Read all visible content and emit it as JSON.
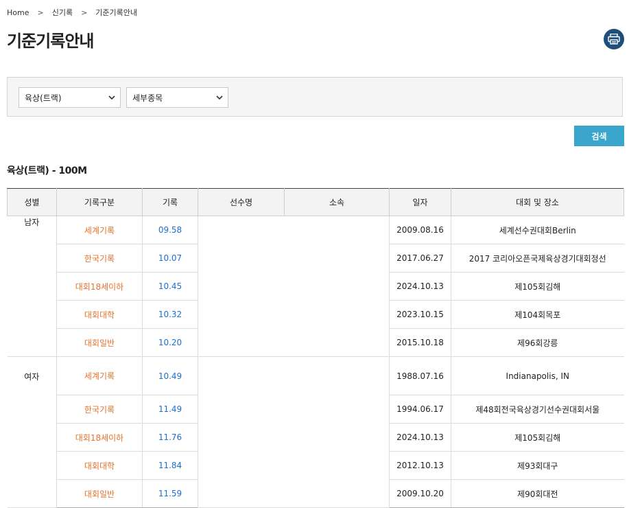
{
  "breadcrumb": {
    "home": "Home",
    "level1": "신기록",
    "level2": "기준기록안내",
    "separator": ">"
  },
  "page_title": "기준기록안내",
  "filters": {
    "category": "육상(트랙)",
    "event": "세부종목"
  },
  "search_label": "검색",
  "section_title": "육상(트랙) - 100M",
  "table": {
    "headers": [
      "성별",
      "기록구분",
      "기록",
      "선수명",
      "소속",
      "일자",
      "대회 및 장소"
    ],
    "groups": [
      {
        "gender": "남자",
        "rows": [
          {
            "category": "세계기록",
            "record": "09.58",
            "date": "2009.08.16",
            "venue": "세계선수권대회Berlin"
          },
          {
            "category": "한국기록",
            "record": "10.07",
            "date": "2017.06.27",
            "venue": "2017 코리아오픈국제육상경기대회정선"
          },
          {
            "category": "대회18세이하",
            "record": "10.45",
            "date": "2024.10.13",
            "venue": "제105회김해"
          },
          {
            "category": "대회대학",
            "record": "10.32",
            "date": "2023.10.15",
            "venue": "제104회목포"
          },
          {
            "category": "대회일반",
            "record": "10.20",
            "date": "2015.10.18",
            "venue": "제96회강릉"
          }
        ]
      },
      {
        "gender": "여자",
        "rows": [
          {
            "category": "세계기록",
            "record": "10.49",
            "date": "1988.07.16",
            "venue": "Indianapolis, IN"
          },
          {
            "category": "한국기록",
            "record": "11.49",
            "date": "1994.06.17",
            "venue": "제48회전국육상경기선수권대회서울"
          },
          {
            "category": "대회18세이하",
            "record": "11.76",
            "date": "2024.10.13",
            "venue": "제105회김해"
          },
          {
            "category": "대회대학",
            "record": "11.84",
            "date": "2012.10.13",
            "venue": "제93회대구"
          },
          {
            "category": "대회일반",
            "record": "11.59",
            "date": "2009.10.20",
            "venue": "제90회대전"
          }
        ]
      }
    ]
  },
  "colors": {
    "accent_button": "#3ba6cc",
    "category_text": "#e8712a",
    "record_text": "#1a6fd0",
    "print_button": "#1f4e7a"
  },
  "icons": {
    "print": "printer-icon",
    "select": "chevron-down-icon"
  }
}
